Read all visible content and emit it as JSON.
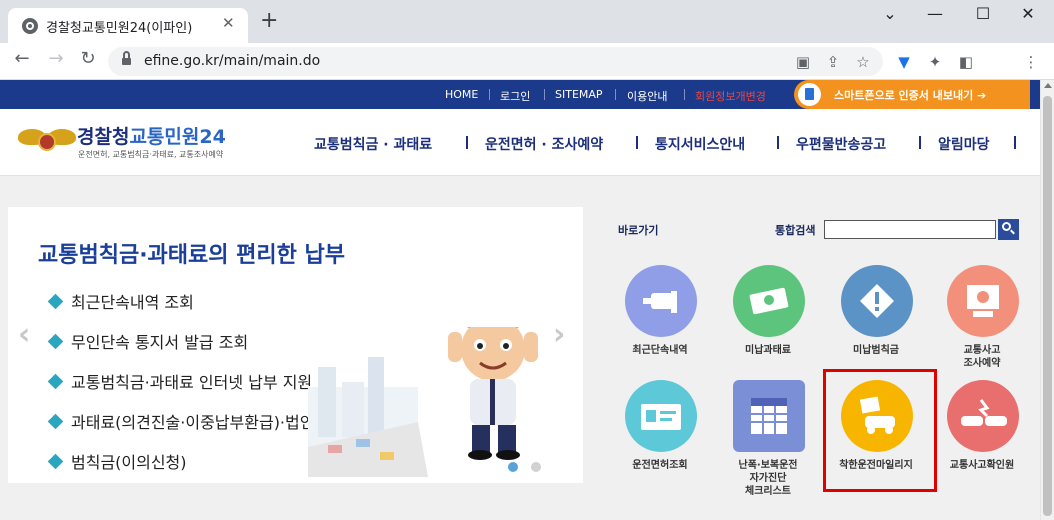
{
  "browser": {
    "tab_title": "경찰청교통민원24(이파인)",
    "tab_close": "✕",
    "new_tab": "+",
    "url": "efine.go.kr/main/main.do",
    "window_controls": [
      "⌄",
      "—",
      "☐",
      "✕"
    ]
  },
  "site": {
    "top_links": [
      "HOME",
      "로그인",
      "SITEMAP",
      "이용안내",
      "회원정보개변경"
    ],
    "smart_button": "스마트폰으로 인증서 내보내기 ➔",
    "logo_title_a": "경찰청",
    "logo_title_b": "교통민원24",
    "logo_sub": "운전면허, 교통범칙금·과태료, 교통조사예약",
    "gnav": [
      "교통범칙금 · 과태료",
      "운전면허 · 조사예약",
      "통지서비스안내",
      "우편물반송공고",
      "알림마당"
    ],
    "banner": {
      "title": "교통범칙금·과태료의 편리한 납부",
      "items": [
        "최근단속내역 조회",
        "무인단속 통지서 발급 조회",
        "교통범칙금·과태료 인터넷 납부 지원 등",
        "과태료(의견진술·이중납부환급)·법인신청",
        "범칙금(이의신청)"
      ],
      "prev": "‹",
      "next": "›"
    },
    "quick": {
      "label": "바로가기",
      "search_label": "통합검색",
      "items": [
        {
          "label": "최근단속내역",
          "color": "#8f9ee6"
        },
        {
          "label": "미납과태료",
          "color": "#5cc47c"
        },
        {
          "label": "미납범칙금",
          "color": "#5b93c6"
        },
        {
          "label": "교통사고\n조사예약",
          "color": "#f2907b"
        },
        {
          "label": "운전면허조회",
          "color": "#5cc8d8"
        },
        {
          "label": "난폭·보복운전\n자가진단\n체크리스트",
          "color": "#7a8fd6"
        },
        {
          "label": "착한운전마일리지",
          "color": "#f7b500"
        },
        {
          "label": "교통사고확인원",
          "color": "#e96f6f"
        }
      ]
    }
  }
}
